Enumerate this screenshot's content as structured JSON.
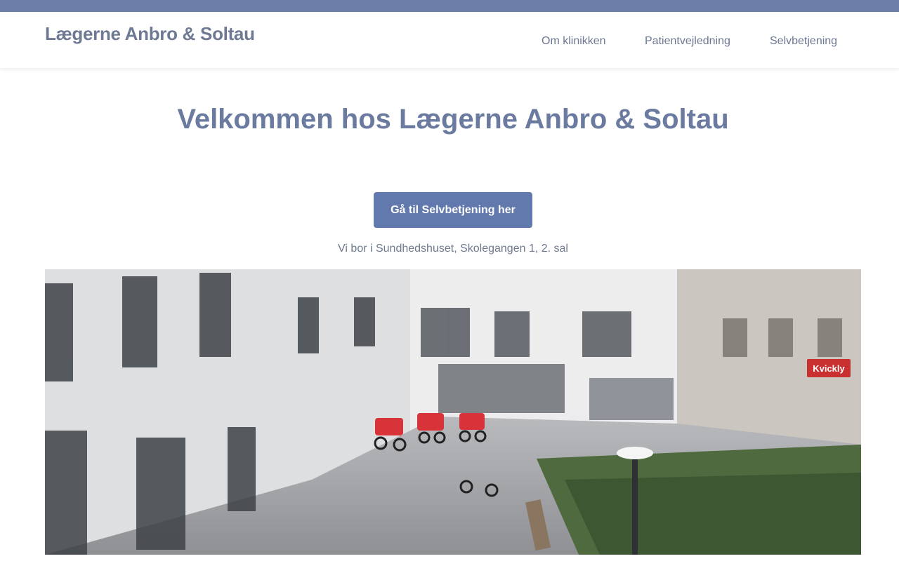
{
  "header": {
    "logo_text": "Lægerne Anbro & Soltau",
    "nav": [
      {
        "label": "Om klinikken"
      },
      {
        "label": "Patientvejledning"
      },
      {
        "label": "Selvbetjening"
      }
    ]
  },
  "hero": {
    "title": "Velkommen hos Lægerne Anbro & Soltau",
    "cta_label": "Gå til Selvbetjening her",
    "address": "Vi bor i Sundhedshuset, Skolegangen 1, 2. sal"
  },
  "photo": {
    "store_sign": "Kvickly"
  },
  "colors": {
    "topbar": "#6b7fa8",
    "title": "#6b7ba0",
    "button": "#6179ad"
  }
}
